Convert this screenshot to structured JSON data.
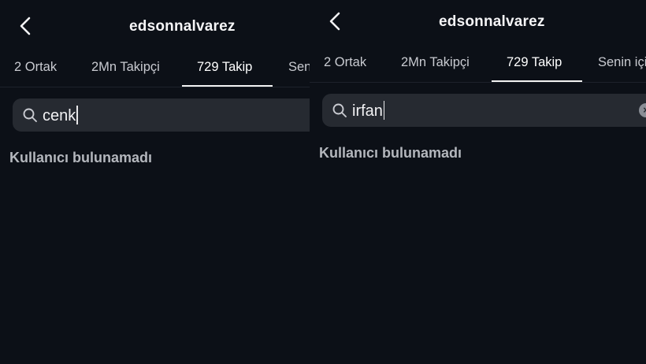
{
  "panels": [
    {
      "header": {
        "title": "edsonnalvarez"
      },
      "tabs": [
        {
          "label": "2 Ortak"
        },
        {
          "label": "2Mn Takipçi"
        },
        {
          "label": "729 Takip"
        },
        {
          "label": "Senin için"
        }
      ],
      "active_tab": "729 Takip",
      "search": {
        "value": "cenk"
      },
      "empty_state": "Kullanıcı bulunamadı"
    },
    {
      "header": {
        "title": "edsonnalvarez"
      },
      "tabs": [
        {
          "label": "2 Ortak"
        },
        {
          "label": "2Mn Takipçi"
        },
        {
          "label": "729 Takip"
        },
        {
          "label": "Senin için"
        }
      ],
      "active_tab": "729 Takip",
      "search": {
        "value": "irfan"
      },
      "empty_state": "Kullanıcı bulunamadı"
    }
  ],
  "colors": {
    "background": "#0c1017",
    "search_bg": "#262a31",
    "muted_text": "#b4b7bd"
  },
  "icons": [
    "back-icon",
    "search-icon",
    "clear-icon"
  ]
}
